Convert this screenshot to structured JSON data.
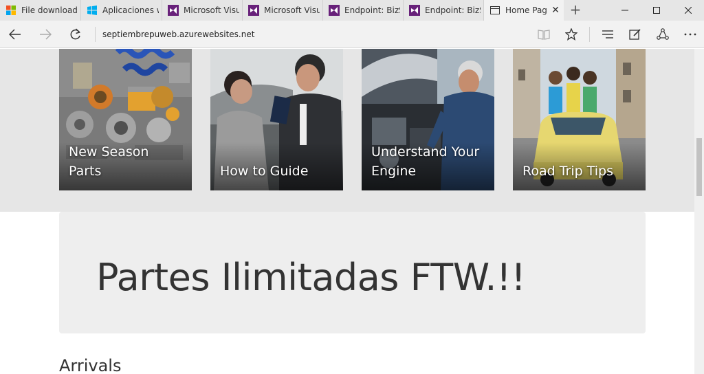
{
  "tabs": [
    {
      "label": "File download e",
      "icon": "windows-store-icon"
    },
    {
      "label": "Aplicaciones we",
      "icon": "windows-logo-icon"
    },
    {
      "label": "Microsoft Visua",
      "icon": "visual-studio-icon"
    },
    {
      "label": "Microsoft Visua",
      "icon": "visual-studio-icon"
    },
    {
      "label": "Endpoint: BizSp",
      "icon": "visual-studio-icon"
    },
    {
      "label": "Endpoint: BizSp",
      "icon": "visual-studio-icon"
    },
    {
      "label": "Home Page",
      "icon": "page-icon",
      "active": true
    }
  ],
  "newtab_label": "+",
  "address": "septiembrepuweb.azurewebsites.net",
  "cards": [
    {
      "caption": "New Season Parts"
    },
    {
      "caption": "How to Guide"
    },
    {
      "caption": "Understand Your Engine"
    },
    {
      "caption": "Road Trip Tips"
    }
  ],
  "jumbotron_title": "Partes Ilimitadas FTW.!!",
  "section_title": "Arrivals",
  "colors": {
    "hero_bg": "#e6e6e6",
    "jumbo_bg": "#eeeeee",
    "tab_bg": "#e6e6e6",
    "active_tab_bg": "#f2f2f2",
    "vs_purple": "#68217a"
  }
}
